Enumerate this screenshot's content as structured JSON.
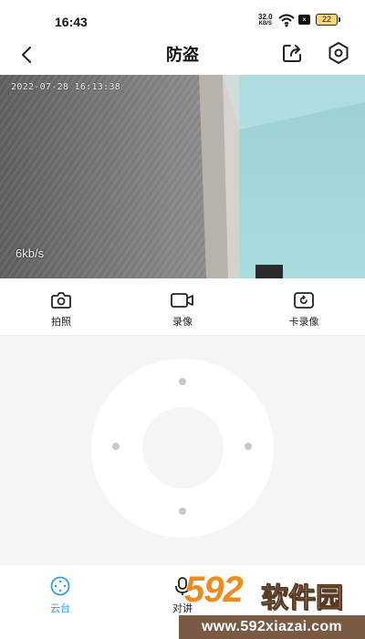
{
  "status_bar": {
    "time": "16:43",
    "net_speed_value": "32.0",
    "net_speed_unit": "KB/S",
    "sim_glyph": "×",
    "battery_level": "22"
  },
  "header": {
    "title": "防盗"
  },
  "video": {
    "timestamp": "2022-07-28 16:13:38",
    "bitrate": "6kb/s"
  },
  "actions": [
    {
      "label": "拍照",
      "icon": "camera-icon"
    },
    {
      "label": "录像",
      "icon": "video-camera-icon"
    },
    {
      "label": "卡录像",
      "icon": "card-playback-icon"
    }
  ],
  "bottom_nav": {
    "tabs": [
      {
        "label": "云台",
        "icon": "ptz-icon",
        "active": true
      },
      {
        "label": "对讲",
        "icon": "microphone-icon",
        "active": false
      }
    ]
  },
  "watermark": {
    "brand_number": "592",
    "brand_text": "软件园",
    "url": "www.592xiazai.com"
  },
  "colors": {
    "accent": "#2a9df4",
    "background": "#f5f5f7",
    "watermark_orange": "#f08a1c",
    "watermark_brown": "#7a5a44"
  }
}
